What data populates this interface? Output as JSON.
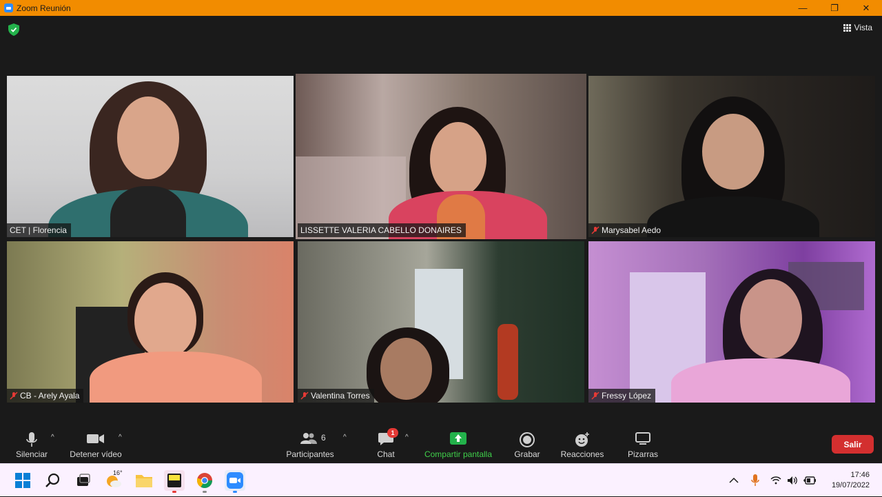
{
  "window": {
    "title": "Zoom Reunión",
    "minimize": "—",
    "maximize": "❐",
    "close": "✕"
  },
  "top": {
    "view_label": "Vista"
  },
  "participants": [
    {
      "name": "CET | Florencia",
      "muted": false,
      "active": false
    },
    {
      "name": "LISSETTE VALERIA CABELLO DONAIRES",
      "muted": false,
      "active": true
    },
    {
      "name": "Marysabel Aedo",
      "muted": true,
      "active": false
    },
    {
      "name": "CB - Arely Ayala",
      "muted": true,
      "active": false
    },
    {
      "name": "Valentina Torres",
      "muted": true,
      "active": false
    },
    {
      "name": "Fressy López",
      "muted": true,
      "active": false
    }
  ],
  "toolbar": {
    "mute_label": "Silenciar",
    "video_label": "Detener vídeo",
    "participants_label": "Participantes",
    "participants_count": "6",
    "chat_label": "Chat",
    "chat_badge": "1",
    "share_label": "Compartir pantalla",
    "record_label": "Grabar",
    "reactions_label": "Reacciones",
    "whiteboard_label": "Pizarras",
    "leave_label": "Salir",
    "caret": "^"
  },
  "taskbar": {
    "weather_temp": "16°",
    "time": "17:46",
    "date": "19/07/2022"
  },
  "colors": {
    "title_bar": "#f28c00",
    "active_speaker": "#d7e86b",
    "share_green": "#3fcf4a",
    "leave_red": "#d32f2f",
    "mute_red": "#e53935"
  },
  "icons": {
    "security": "shield-check-icon",
    "view": "grid-icon",
    "mic": "microphone-icon",
    "video": "video-camera-icon",
    "participants": "people-icon",
    "chat": "chat-bubble-icon",
    "share": "share-screen-icon",
    "record": "record-icon",
    "reactions": "emoji-plus-icon",
    "whiteboard": "whiteboard-icon"
  }
}
